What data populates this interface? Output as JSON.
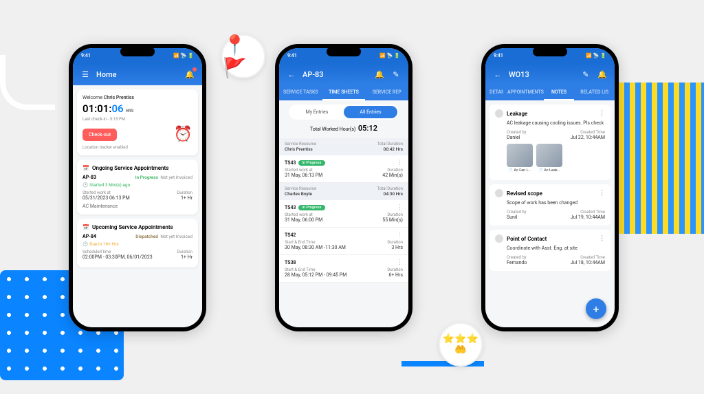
{
  "status_time": "9:41",
  "colors": {
    "primary": "#2e7ee6",
    "danger": "#ff5c5c",
    "success": "#33b76b"
  },
  "phone1": {
    "title": "Home",
    "welcome_prefix": "Welcome ",
    "welcome_name": "Chris Prentiss",
    "timer_hm": "01:01:",
    "timer_s": "06",
    "timer_unit": "HRS",
    "last_checkin": "Last check-in - 5:15 PM",
    "checkout": "Check-out",
    "tracker": "Location tracker enabled",
    "ongoing_title": "Ongoing Service Appointments",
    "ap83": {
      "id": "AP-83",
      "status": "In Progress",
      "invoice": "Not yet Invoiced",
      "started": "Started 3 Min(s) ago",
      "started_at_label": "Started work at",
      "started_at_value": "05/31/2023 06:13 PM",
      "duration_label": "Duration",
      "duration_value": "1+ Hr",
      "service": "AC Maintenance"
    },
    "upcoming_title": "Upcoming Service Appointments",
    "ap84": {
      "id": "AP-84",
      "status": "Dispatched",
      "invoice": "Not yet Invoiced",
      "due": "Due in 19+ Hrs",
      "sched_label": "Scheduled time",
      "sched_value": "02:00PM - 03:30PM, 06/01/2023",
      "duration_label": "Duration",
      "duration_value": "1+ Hr"
    }
  },
  "phone2": {
    "title": "AP-83",
    "tabs": [
      "SERVICE TASKS",
      "TIME SHEETS",
      "SERVICE REP"
    ],
    "active_tab": 1,
    "toggle": {
      "my": "My Entries",
      "all": "All Entries"
    },
    "total_label": "Total Worked Hour(s)",
    "total_value": "05:12",
    "resources": [
      {
        "label": "Service Resource",
        "name": "Chris Prentiss",
        "total_label": "Total Duration",
        "total": "00:42 Hrs",
        "entries": [
          {
            "id": "TS43",
            "status": "In Progress",
            "row1_label": "Started work at",
            "row1_value": "31 May, 06:13 PM",
            "dur_label": "Duration",
            "dur": "42 Min(s)"
          }
        ]
      },
      {
        "label": "Service Resource",
        "name": "Charles Boyle",
        "total_label": "Total Duration",
        "total": "04:30 Hrs",
        "entries": [
          {
            "id": "TS43",
            "status": "In Progress",
            "row1_label": "Started work at",
            "row1_value": "31 May, 06:00 PM",
            "dur_label": "Duration",
            "dur": "55 Min(s)"
          },
          {
            "id": "TS42",
            "status": "",
            "row1_label": "Start & End Time",
            "row1_value": "30 May, 08:30 AM -11:30 AM",
            "dur_label": "Duration",
            "dur": "3 Hrs"
          },
          {
            "id": "TS38",
            "status": "",
            "row1_label": "Start & End Time",
            "row1_value": "28 May, 05:12 PM - 09:45 PM",
            "dur_label": "Duration",
            "dur": "6+ Hrs"
          }
        ]
      }
    ]
  },
  "phone3": {
    "title": "WO13",
    "tabs": [
      "DETAILS",
      "APPOINTMENTS",
      "NOTES",
      "RELATED LIS"
    ],
    "active_tab": 2,
    "notes": [
      {
        "title": "Leakage",
        "body": "AC leakage causing cooling issues. Pls check",
        "created_by_label": "Created by",
        "created_by": "Daniel",
        "created_time_label": "Created Time",
        "created_time": "Jul 22, 10:44AM",
        "attachments": [
          "Ac Fan L...",
          "Ac Leak..."
        ]
      },
      {
        "title": "Revised scope",
        "body": "Scope of work has been changed",
        "created_by_label": "Created by",
        "created_by": "Sunil",
        "created_time_label": "Created Time",
        "created_time": "Jul 19, 10:44AM"
      },
      {
        "title": "Point of Contact",
        "body": "Coordinate with Asst. Eng. at site",
        "created_by_label": "Created by",
        "created_by": "Fernando",
        "created_time_label": "Created Time",
        "created_time": "Jul 18, 10:44AM"
      }
    ]
  }
}
